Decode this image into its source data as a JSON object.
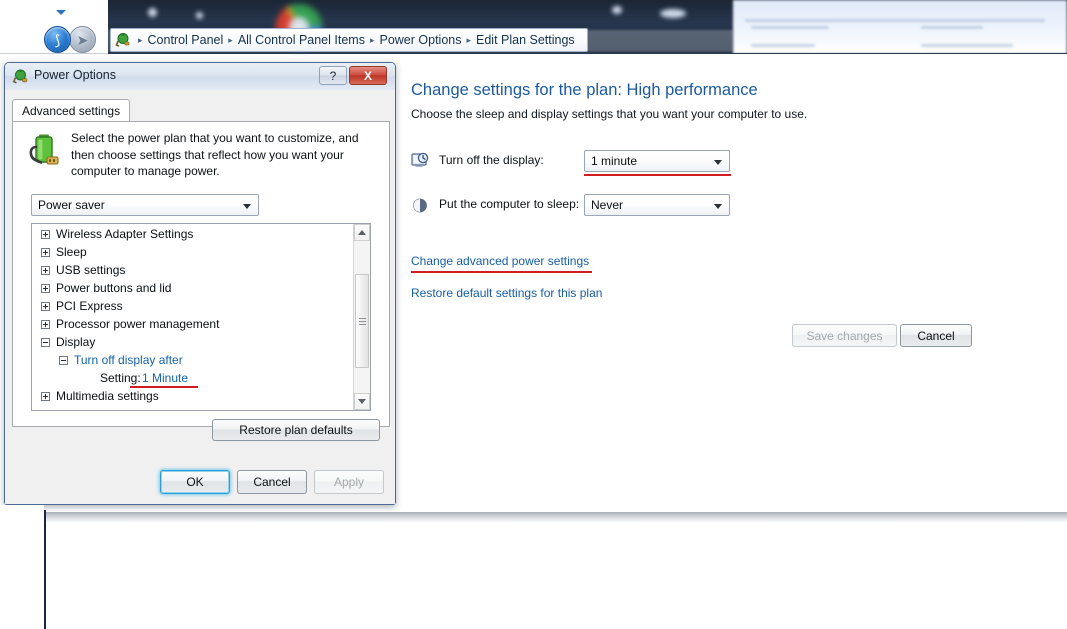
{
  "explorer": {
    "nav": {
      "back_icon": "back-arrow-icon",
      "forward_icon": "forward-arrow-icon",
      "history_icon": "chevron-down-icon"
    },
    "breadcrumb_icon": "power-options-icon",
    "breadcrumb": [
      "Control Panel",
      "All Control Panel Items",
      "Power Options",
      "Edit Plan Settings"
    ],
    "separator": "▸"
  },
  "content": {
    "title": "Change settings for the plan: High performance",
    "subtitle": "Choose the sleep and display settings that you want your computer to use.",
    "settings": [
      {
        "icon": "monitor-clock-icon",
        "label": "Turn off the display:",
        "value": "1 minute",
        "highlighted": true
      },
      {
        "icon": "moon-sleep-icon",
        "label": "Put the computer to sleep:",
        "value": "Never",
        "highlighted": false
      }
    ],
    "links": [
      {
        "text": "Change advanced power settings",
        "highlighted": true
      },
      {
        "text": "Restore default settings for this plan",
        "highlighted": false
      }
    ],
    "buttons": {
      "save": "Save changes",
      "save_disabled": true,
      "cancel": "Cancel"
    }
  },
  "dialog": {
    "title": "Power Options",
    "title_icon": "power-plug-icon",
    "help_label": "?",
    "close_label": "X",
    "tab": "Advanced settings",
    "battery_icon": "battery-plug-icon",
    "description": "Select the power plan that you want to customize, and then choose settings that reflect how you want your computer to manage power.",
    "plan_select": "Power saver",
    "tree": [
      {
        "label": "Wireless Adapter Settings",
        "state": "collapsed",
        "indent": 0,
        "blue": false
      },
      {
        "label": "Sleep",
        "state": "collapsed",
        "indent": 0,
        "blue": false
      },
      {
        "label": "USB settings",
        "state": "collapsed",
        "indent": 0,
        "blue": false
      },
      {
        "label": "Power buttons and lid",
        "state": "collapsed",
        "indent": 0,
        "blue": false
      },
      {
        "label": "PCI Express",
        "state": "collapsed",
        "indent": 0,
        "blue": false
      },
      {
        "label": "Processor power management",
        "state": "collapsed",
        "indent": 0,
        "blue": false
      },
      {
        "label": "Display",
        "state": "expanded",
        "indent": 0,
        "blue": false
      },
      {
        "label": "Turn off display after",
        "state": "expanded",
        "indent": 1,
        "blue": true
      },
      {
        "label": "Setting:",
        "value": "1 Minute",
        "state": "none",
        "indent": 2,
        "blue": false,
        "highlighted": true
      },
      {
        "label": "Multimedia settings",
        "state": "collapsed",
        "indent": 0,
        "blue": false
      }
    ],
    "restore_button": "Restore plan defaults",
    "buttons": {
      "ok": "OK",
      "cancel": "Cancel",
      "apply": "Apply",
      "apply_disabled": true,
      "ok_default": true
    }
  },
  "colors": {
    "link_blue": "#175ea6",
    "title_blue": "#1b5a9e",
    "annotation_red": "#cf1d21",
    "close_red": "#cf4d3f"
  }
}
